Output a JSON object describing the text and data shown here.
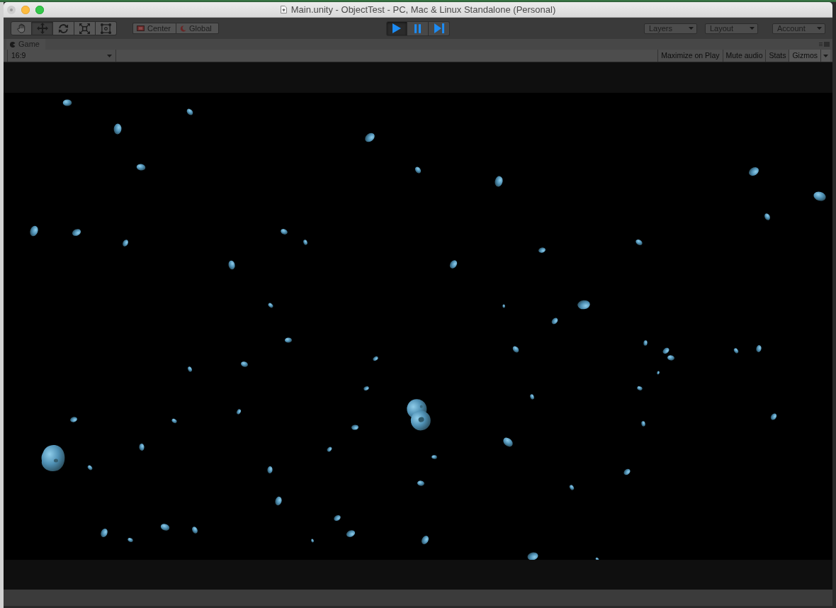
{
  "window": {
    "title": "Main.unity - ObjectTest - PC, Mac & Linux Standalone (Personal)",
    "buttons": [
      {
        "kind": "close",
        "color": "#cdcdcd"
      },
      {
        "kind": "minimize",
        "color": "#fdbc40"
      },
      {
        "kind": "zoom",
        "color": "#34c84a"
      }
    ]
  },
  "toolbar": {
    "tools": [
      {
        "kind": "hand",
        "selected": false
      },
      {
        "kind": "move",
        "selected": true
      },
      {
        "kind": "rotate",
        "selected": false
      },
      {
        "kind": "scale",
        "selected": false
      },
      {
        "kind": "rect",
        "selected": false
      }
    ],
    "pivot": [
      {
        "kind": "position",
        "label": "Center"
      },
      {
        "kind": "rotation",
        "label": "Global"
      }
    ],
    "playback": [
      {
        "kind": "play",
        "on": true
      },
      {
        "kind": "pause",
        "on": false
      },
      {
        "kind": "step",
        "on": false
      }
    ],
    "menus": [
      {
        "label": "Layers"
      },
      {
        "label": "Layout"
      },
      {
        "label": "Account"
      }
    ]
  },
  "game_panel": {
    "tab": {
      "label": "Game"
    },
    "aspect": {
      "value": "16:9"
    },
    "toggles": [
      {
        "label": "Maximize on Play"
      },
      {
        "label": "Mute audio"
      },
      {
        "label": "Stats"
      }
    ],
    "gizmos": {
      "label": "Gizmos"
    }
  }
}
